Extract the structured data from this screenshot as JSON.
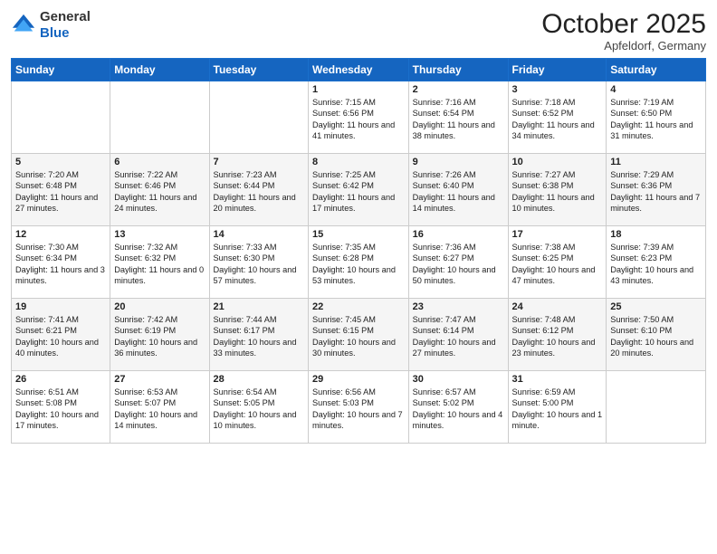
{
  "header": {
    "logo_line1": "General",
    "logo_line2": "Blue",
    "month": "October 2025",
    "location": "Apfeldorf, Germany"
  },
  "days_of_week": [
    "Sunday",
    "Monday",
    "Tuesday",
    "Wednesday",
    "Thursday",
    "Friday",
    "Saturday"
  ],
  "weeks": [
    [
      {
        "day": "",
        "sunrise": "",
        "sunset": "",
        "daylight": ""
      },
      {
        "day": "",
        "sunrise": "",
        "sunset": "",
        "daylight": ""
      },
      {
        "day": "",
        "sunrise": "",
        "sunset": "",
        "daylight": ""
      },
      {
        "day": "1",
        "sunrise": "Sunrise: 7:15 AM",
        "sunset": "Sunset: 6:56 PM",
        "daylight": "Daylight: 11 hours and 41 minutes."
      },
      {
        "day": "2",
        "sunrise": "Sunrise: 7:16 AM",
        "sunset": "Sunset: 6:54 PM",
        "daylight": "Daylight: 11 hours and 38 minutes."
      },
      {
        "day": "3",
        "sunrise": "Sunrise: 7:18 AM",
        "sunset": "Sunset: 6:52 PM",
        "daylight": "Daylight: 11 hours and 34 minutes."
      },
      {
        "day": "4",
        "sunrise": "Sunrise: 7:19 AM",
        "sunset": "Sunset: 6:50 PM",
        "daylight": "Daylight: 11 hours and 31 minutes."
      }
    ],
    [
      {
        "day": "5",
        "sunrise": "Sunrise: 7:20 AM",
        "sunset": "Sunset: 6:48 PM",
        "daylight": "Daylight: 11 hours and 27 minutes."
      },
      {
        "day": "6",
        "sunrise": "Sunrise: 7:22 AM",
        "sunset": "Sunset: 6:46 PM",
        "daylight": "Daylight: 11 hours and 24 minutes."
      },
      {
        "day": "7",
        "sunrise": "Sunrise: 7:23 AM",
        "sunset": "Sunset: 6:44 PM",
        "daylight": "Daylight: 11 hours and 20 minutes."
      },
      {
        "day": "8",
        "sunrise": "Sunrise: 7:25 AM",
        "sunset": "Sunset: 6:42 PM",
        "daylight": "Daylight: 11 hours and 17 minutes."
      },
      {
        "day": "9",
        "sunrise": "Sunrise: 7:26 AM",
        "sunset": "Sunset: 6:40 PM",
        "daylight": "Daylight: 11 hours and 14 minutes."
      },
      {
        "day": "10",
        "sunrise": "Sunrise: 7:27 AM",
        "sunset": "Sunset: 6:38 PM",
        "daylight": "Daylight: 11 hours and 10 minutes."
      },
      {
        "day": "11",
        "sunrise": "Sunrise: 7:29 AM",
        "sunset": "Sunset: 6:36 PM",
        "daylight": "Daylight: 11 hours and 7 minutes."
      }
    ],
    [
      {
        "day": "12",
        "sunrise": "Sunrise: 7:30 AM",
        "sunset": "Sunset: 6:34 PM",
        "daylight": "Daylight: 11 hours and 3 minutes."
      },
      {
        "day": "13",
        "sunrise": "Sunrise: 7:32 AM",
        "sunset": "Sunset: 6:32 PM",
        "daylight": "Daylight: 11 hours and 0 minutes."
      },
      {
        "day": "14",
        "sunrise": "Sunrise: 7:33 AM",
        "sunset": "Sunset: 6:30 PM",
        "daylight": "Daylight: 10 hours and 57 minutes."
      },
      {
        "day": "15",
        "sunrise": "Sunrise: 7:35 AM",
        "sunset": "Sunset: 6:28 PM",
        "daylight": "Daylight: 10 hours and 53 minutes."
      },
      {
        "day": "16",
        "sunrise": "Sunrise: 7:36 AM",
        "sunset": "Sunset: 6:27 PM",
        "daylight": "Daylight: 10 hours and 50 minutes."
      },
      {
        "day": "17",
        "sunrise": "Sunrise: 7:38 AM",
        "sunset": "Sunset: 6:25 PM",
        "daylight": "Daylight: 10 hours and 47 minutes."
      },
      {
        "day": "18",
        "sunrise": "Sunrise: 7:39 AM",
        "sunset": "Sunset: 6:23 PM",
        "daylight": "Daylight: 10 hours and 43 minutes."
      }
    ],
    [
      {
        "day": "19",
        "sunrise": "Sunrise: 7:41 AM",
        "sunset": "Sunset: 6:21 PM",
        "daylight": "Daylight: 10 hours and 40 minutes."
      },
      {
        "day": "20",
        "sunrise": "Sunrise: 7:42 AM",
        "sunset": "Sunset: 6:19 PM",
        "daylight": "Daylight: 10 hours and 36 minutes."
      },
      {
        "day": "21",
        "sunrise": "Sunrise: 7:44 AM",
        "sunset": "Sunset: 6:17 PM",
        "daylight": "Daylight: 10 hours and 33 minutes."
      },
      {
        "day": "22",
        "sunrise": "Sunrise: 7:45 AM",
        "sunset": "Sunset: 6:15 PM",
        "daylight": "Daylight: 10 hours and 30 minutes."
      },
      {
        "day": "23",
        "sunrise": "Sunrise: 7:47 AM",
        "sunset": "Sunset: 6:14 PM",
        "daylight": "Daylight: 10 hours and 27 minutes."
      },
      {
        "day": "24",
        "sunrise": "Sunrise: 7:48 AM",
        "sunset": "Sunset: 6:12 PM",
        "daylight": "Daylight: 10 hours and 23 minutes."
      },
      {
        "day": "25",
        "sunrise": "Sunrise: 7:50 AM",
        "sunset": "Sunset: 6:10 PM",
        "daylight": "Daylight: 10 hours and 20 minutes."
      }
    ],
    [
      {
        "day": "26",
        "sunrise": "Sunrise: 6:51 AM",
        "sunset": "Sunset: 5:08 PM",
        "daylight": "Daylight: 10 hours and 17 minutes."
      },
      {
        "day": "27",
        "sunrise": "Sunrise: 6:53 AM",
        "sunset": "Sunset: 5:07 PM",
        "daylight": "Daylight: 10 hours and 14 minutes."
      },
      {
        "day": "28",
        "sunrise": "Sunrise: 6:54 AM",
        "sunset": "Sunset: 5:05 PM",
        "daylight": "Daylight: 10 hours and 10 minutes."
      },
      {
        "day": "29",
        "sunrise": "Sunrise: 6:56 AM",
        "sunset": "Sunset: 5:03 PM",
        "daylight": "Daylight: 10 hours and 7 minutes."
      },
      {
        "day": "30",
        "sunrise": "Sunrise: 6:57 AM",
        "sunset": "Sunset: 5:02 PM",
        "daylight": "Daylight: 10 hours and 4 minutes."
      },
      {
        "day": "31",
        "sunrise": "Sunrise: 6:59 AM",
        "sunset": "Sunset: 5:00 PM",
        "daylight": "Daylight: 10 hours and 1 minute."
      },
      {
        "day": "",
        "sunrise": "",
        "sunset": "",
        "daylight": ""
      }
    ]
  ]
}
